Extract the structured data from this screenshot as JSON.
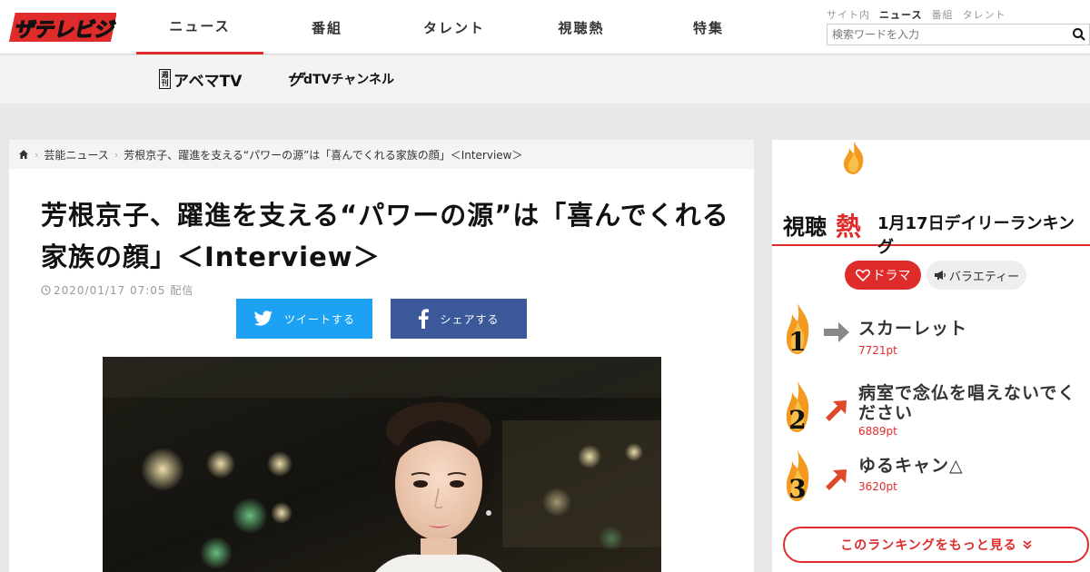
{
  "site": {
    "logo_text": "ザテレビジョン"
  },
  "nav": {
    "items": [
      {
        "label": "ニュース"
      },
      {
        "label": "番組"
      },
      {
        "label": "タレント"
      },
      {
        "label": "視聴熱"
      },
      {
        "label": "特集"
      }
    ]
  },
  "search": {
    "tabs": [
      {
        "label": "サイト内"
      },
      {
        "label": "ニュース"
      },
      {
        "label": "番組"
      },
      {
        "label": "タレント"
      }
    ],
    "placeholder": "検索ワードを入力"
  },
  "subnav": {
    "weekly_badge": "週刊",
    "abema_label": "アベマTV",
    "za_mark": "ザ",
    "dtv_label": "dTVチャンネル"
  },
  "breadcrumb": {
    "items": [
      "芸能ニュース",
      "芳根京子、躍進を支える“パワーの源”は「喜んでくれる家族の顔」＜Interview＞"
    ]
  },
  "article": {
    "title": "芳根京子、躍進を支える“パワーの源”は「喜んでくれる家族の顔」＜Interview＞",
    "date": "2020/01/17 07:05 配信",
    "tweet_label": "ツイートする",
    "share_label": "シェアする"
  },
  "ranking": {
    "heading_prefix": "視聴",
    "heading_accent": "熱",
    "heading_date": "1月17日デイリーランキング",
    "tabs": [
      {
        "label": "ドラマ"
      },
      {
        "label": "バラエティー"
      }
    ],
    "items": [
      {
        "rank": "1",
        "title": "スカーレット",
        "points": "7721pt",
        "trend": "flat"
      },
      {
        "rank": "2",
        "title": "病室で念仏を唱えないでください",
        "points": "6889pt",
        "trend": "up"
      },
      {
        "rank": "3",
        "title": "ゆるキャン△",
        "points": "3620pt",
        "trend": "up"
      }
    ],
    "more_label": "このランキングをもっと見る"
  },
  "colors": {
    "accent": "#e02b2b",
    "twitter": "#1da1f2",
    "facebook": "#3b5998",
    "flame": "#f39a1e"
  }
}
